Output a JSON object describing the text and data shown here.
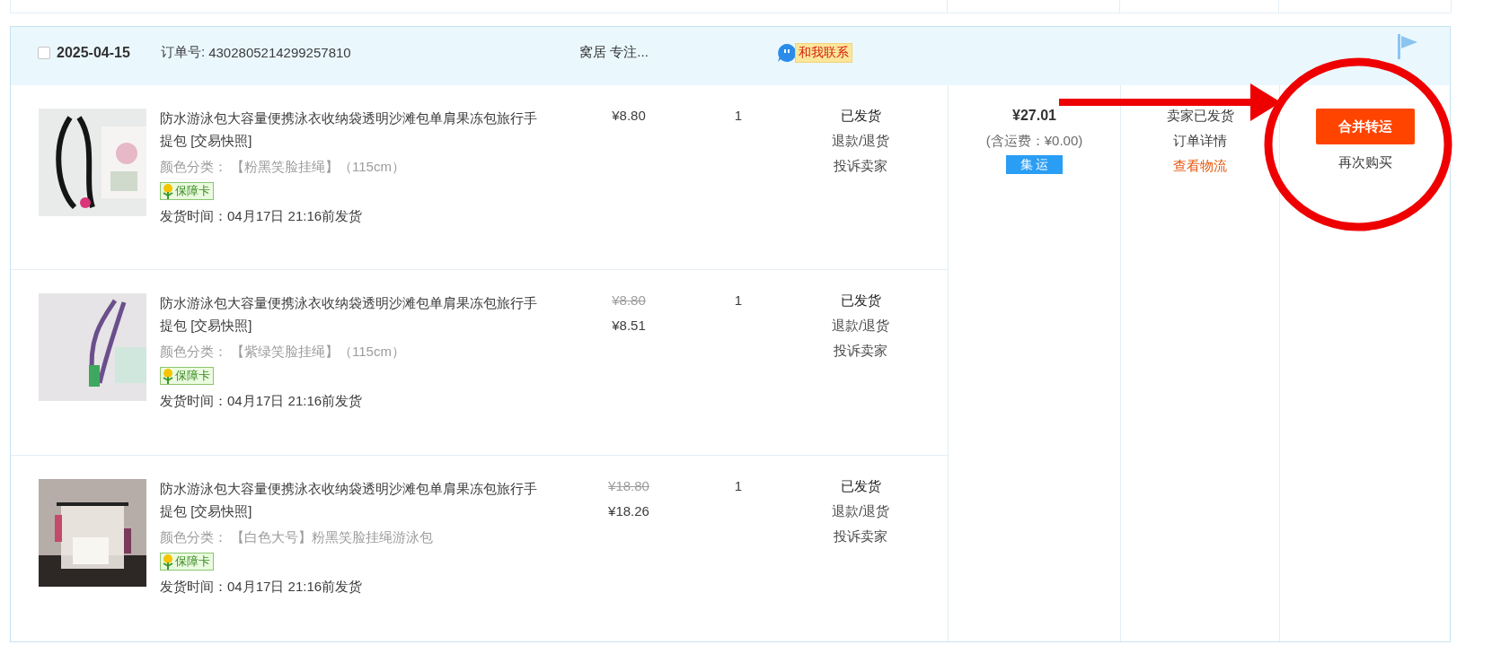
{
  "order": {
    "checked": false,
    "date": "2025-04-15",
    "order_no_label": "订单号:",
    "order_no": "4302805214299257810",
    "shop": "窝居 专注...",
    "contact": "和我联系",
    "items": [
      {
        "title": "防水游泳包大容量便携泳衣收纳袋透明沙滩包单肩果冻包旅行手提包 [交易快照]",
        "spec_label": "颜色分类：",
        "spec": "【粉黑笑脸挂绳】（115cm）",
        "guarantee": "保障卡",
        "ship_time": "发货时间：04月17日 21:16前发货",
        "price": "¥8.80",
        "qty": "1",
        "status": [
          {
            "text": "已发货",
            "kind": "status"
          },
          {
            "text": "退款/退货",
            "kind": "link"
          },
          {
            "text": "投诉卖家",
            "kind": "link"
          }
        ]
      },
      {
        "title": "防水游泳包大容量便携泳衣收纳袋透明沙滩包单肩果冻包旅行手提包 [交易快照]",
        "spec_label": "颜色分类：",
        "spec": "【紫绿笑脸挂绳】（115cm）",
        "guarantee": "保障卡",
        "ship_time": "发货时间：04月17日 21:16前发货",
        "original_price": "¥8.80",
        "price": "¥8.51",
        "qty": "1",
        "status": [
          {
            "text": "已发货",
            "kind": "status"
          },
          {
            "text": "退款/退货",
            "kind": "link"
          },
          {
            "text": "投诉卖家",
            "kind": "link"
          }
        ]
      },
      {
        "title": "防水游泳包大容量便携泳衣收纳袋透明沙滩包单肩果冻包旅行手提包 [交易快照]",
        "spec_label": "颜色分类：",
        "spec": "【白色大号】粉黑笑脸挂绳游泳包",
        "guarantee": "保障卡",
        "ship_time": "发货时间：04月17日 21:16前发货",
        "original_price": "¥18.80",
        "price": "¥18.26",
        "qty": "1",
        "status": [
          {
            "text": "已发货",
            "kind": "status"
          },
          {
            "text": "退款/退货",
            "kind": "link"
          },
          {
            "text": "投诉卖家",
            "kind": "link"
          }
        ]
      }
    ],
    "total": "¥27.01",
    "shipping": "(含运费：¥0.00)",
    "tag": "集 运",
    "operations": [
      {
        "text": "卖家已发货",
        "kind": "plain"
      },
      {
        "text": "订单详情",
        "kind": "plain"
      },
      {
        "text": "查看物流",
        "kind": "link"
      }
    ],
    "actions": [
      {
        "text": "合并转运",
        "kind": "primary"
      },
      {
        "text": "再次购买",
        "kind": "secondary"
      }
    ]
  },
  "annotations": {
    "arrow": true,
    "circle": true
  }
}
